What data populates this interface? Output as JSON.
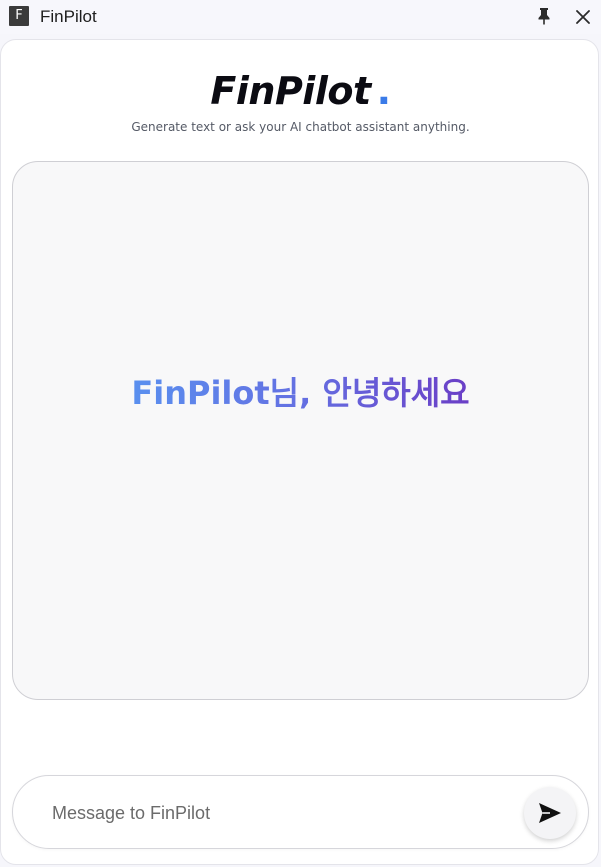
{
  "window": {
    "icon_letter": "F",
    "title": "FinPilot",
    "pin_icon": "pin-icon",
    "close_icon": "close-icon"
  },
  "header": {
    "brand": "FinPilot",
    "brand_dot": ".",
    "subtitle": "Generate text or ask your AI chatbot assistant anything."
  },
  "chat": {
    "greeting": "FinPilot님, 안녕하세요"
  },
  "composer": {
    "placeholder": "Message to FinPilot",
    "value": "",
    "send_icon": "send-icon"
  },
  "colors": {
    "brand_dot": "#3a7be8",
    "greeting_gradient_start": "#5a90ef",
    "greeting_gradient_end": "#6a3ec6"
  }
}
